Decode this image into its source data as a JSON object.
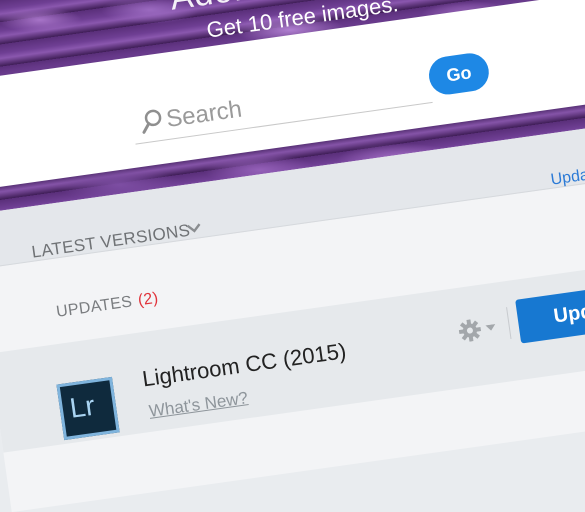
{
  "hero": {
    "title": "Adob",
    "subtitle": "Get 10 free images."
  },
  "search": {
    "placeholder": "Search",
    "go_label": "Go"
  },
  "latest": {
    "label": "LATEST VERSIONS",
    "update_link": "Update"
  },
  "updates": {
    "label": "UPDATES",
    "count": "(2)"
  },
  "apps": [
    {
      "icon_text": "Lr",
      "name": "Lightroom CC (2015)",
      "link": "What's New?",
      "button": "Update"
    }
  ],
  "colors": {
    "accent": "#1e88e5",
    "badge": "#e0323a",
    "lr_icon_bg": "#0f2a3d"
  }
}
